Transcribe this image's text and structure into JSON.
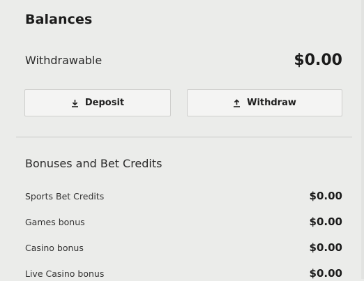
{
  "balances": {
    "title": "Balances",
    "withdrawable_label": "Withdrawable",
    "withdrawable_value": "$0.00"
  },
  "actions": {
    "deposit_label": "Deposit",
    "deposit_icon": "download-icon",
    "withdraw_label": "Withdraw",
    "withdraw_icon": "upload-icon"
  },
  "bonuses": {
    "title": "Bonuses and Bet Credits",
    "items": [
      {
        "label": "Sports Bet Credits",
        "value": "$0.00"
      },
      {
        "label": "Games bonus",
        "value": "$0.00"
      },
      {
        "label": "Casino bonus",
        "value": "$0.00"
      },
      {
        "label": "Live Casino bonus",
        "value": "$0.00"
      }
    ]
  }
}
